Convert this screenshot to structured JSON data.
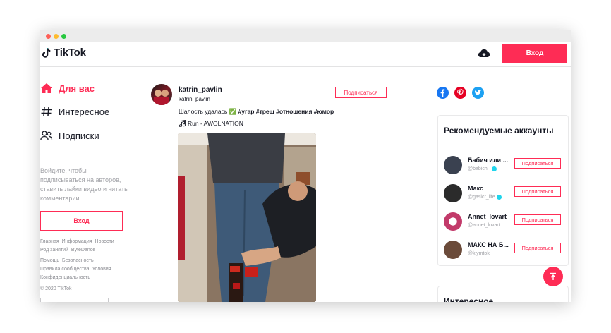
{
  "header": {
    "logo_text": "TikTok",
    "login_label": "Вход",
    "upload_icon": "cloud-upload-icon"
  },
  "nav": {
    "items": [
      {
        "label": "Для вас",
        "icon": "home-icon",
        "active": true
      },
      {
        "label": "Интересное",
        "icon": "hashtag-icon",
        "active": false
      },
      {
        "label": "Подписки",
        "icon": "users-icon",
        "active": false
      }
    ],
    "hint": "Войдите, чтобы подписываться на авторов, ставить лайки видео и читать комментарии.",
    "login_label": "Вход"
  },
  "footer": {
    "row1": [
      "Главная",
      "Информация",
      "Новости"
    ],
    "row2": [
      "Род занятий",
      "ByteDance"
    ],
    "row3": [
      "Помощь",
      "Безопасность"
    ],
    "row4": [
      "Правила сообщества",
      "Условия"
    ],
    "row5": [
      "Конфиденциальность"
    ],
    "copyright": "© 2020 TikTok"
  },
  "post": {
    "username": "katrin_pavlin",
    "nickname": "katrin_pavlin",
    "follow_label": "Подписаться",
    "caption_text": "Шалость удалась ✅",
    "hashtags": "#угар #треш #отношения #юмор",
    "music": "Run - AWOLNATION"
  },
  "recommended": {
    "title": "Рекомендуемые аккаунты",
    "follow_label": "Подписаться",
    "accounts": [
      {
        "name": "Бабич или ...",
        "handle": "@babich_",
        "verified": true,
        "color": "#3a4150"
      },
      {
        "name": "Макс",
        "handle": "@gasicr_life",
        "verified": true,
        "color": "#2b2b2b"
      },
      {
        "name": "Annet_lovart",
        "handle": "@annet_lovart",
        "verified": false,
        "color": "#c23a6a"
      },
      {
        "name": "МАКС НА Б...",
        "handle": "@klymtok",
        "verified": false,
        "color": "#6b4b3a"
      }
    ]
  },
  "interesting": {
    "title": "Интересное"
  },
  "colors": {
    "accent": "#fe2c55",
    "facebook": "#1877f2",
    "pinterest": "#e60023",
    "twitter": "#1da1f2"
  }
}
